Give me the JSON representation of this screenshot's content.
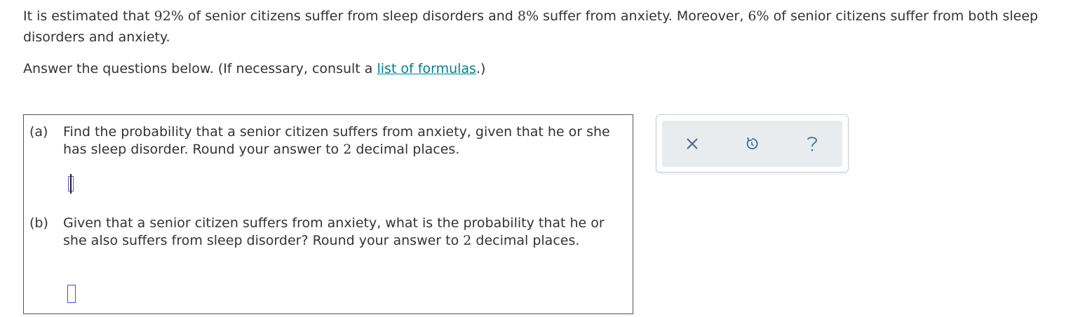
{
  "problem": {
    "intro_p1": "It is estimated that ",
    "pct_sleep": "92%",
    "intro_p2": " of senior citizens suffer from sleep disorders and ",
    "pct_anxiety": "8%",
    "intro_p3": " suffer from anxiety. Moreover, ",
    "pct_both": "6%",
    "intro_p4": " of senior citizens suffer from both sleep disorders and anxiety.",
    "instruction_prefix": "Answer the questions below. (If necessary, consult a ",
    "formulas_link": "list of formulas",
    "instruction_suffix": ".)"
  },
  "questions": [
    {
      "label": "(a)",
      "text_p1": "Find the probability that a senior citizen suffers from anxiety, given that he or she has sleep disorder. Round your answer to ",
      "decimals": "2",
      "text_p2": " decimal places.",
      "answer": ""
    },
    {
      "label": "(b)",
      "text_p1": "Given that a senior citizen suffers from anxiety, what is the probability that he or she also suffers from sleep disorder? Round your answer to ",
      "decimals": "2",
      "text_p2": " decimal places.",
      "answer": ""
    }
  ],
  "toolbar": {
    "icons": [
      "close-icon",
      "reset-icon",
      "help-icon"
    ],
    "icon_color": "#4b6a80"
  }
}
